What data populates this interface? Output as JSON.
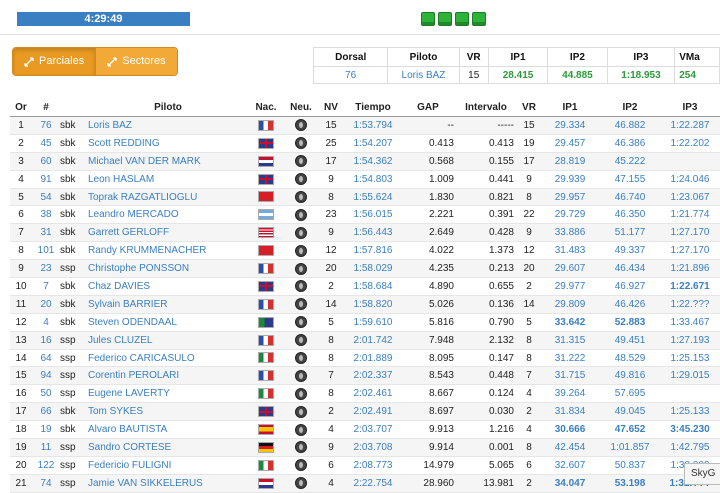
{
  "timer": "4:29:49",
  "buttons": {
    "parciales": "Parciales",
    "sectores": "Sectores"
  },
  "summary": {
    "headers": [
      "Dorsal",
      "Piloto",
      "VR",
      "IP1",
      "IP2",
      "IP3",
      "VMa"
    ],
    "values": [
      "76",
      "Loris BAZ",
      "15",
      "28.415",
      "44.885",
      "1:18.953",
      "254"
    ]
  },
  "headers": [
    "Or",
    "#",
    "",
    "Piloto",
    "Nac.",
    "Neu.",
    "NV",
    "Tiempo",
    "GAP",
    "Intervalo",
    "VR",
    "IP1",
    "IP2",
    "IP3"
  ],
  "rows": [
    [
      "1",
      "76",
      "sbk",
      "Loris BAZ",
      "fr",
      "15",
      "1:53.794",
      "--",
      "-----",
      "15",
      "29.334",
      "46.882",
      "1:22.287"
    ],
    [
      "2",
      "45",
      "sbk",
      "Scott REDDING",
      "gb",
      "25",
      "1:54.207",
      "0.413",
      "0.413",
      "19",
      "29.457",
      "46.386",
      "1:22.202"
    ],
    [
      "3",
      "60",
      "sbk",
      "Michael VAN DER MARK",
      "nl",
      "17",
      "1:54.362",
      "0.568",
      "0.155",
      "17",
      "28.819",
      "45.222",
      ""
    ],
    [
      "4",
      "91",
      "sbk",
      "Leon HASLAM",
      "gb",
      "9",
      "1:54.803",
      "1.009",
      "0.441",
      "9",
      "29.939",
      "47.155",
      "1:24.046"
    ],
    [
      "5",
      "54",
      "sbk",
      "Toprak RAZGATLIOGLU",
      "tr",
      "8",
      "1:55.624",
      "1.830",
      "0.821",
      "8",
      "29.957",
      "46.740",
      "1:23.067"
    ],
    [
      "6",
      "38",
      "sbk",
      "Leandro MERCADO",
      "ar",
      "23",
      "1:56.015",
      "2.221",
      "0.391",
      "22",
      "29.729",
      "46.350",
      "1:21.774"
    ],
    [
      "7",
      "31",
      "sbk",
      "Garrett GERLOFF",
      "us",
      "9",
      "1:56.443",
      "2.649",
      "0.428",
      "9",
      "33.886",
      "51.177",
      "1:27.170"
    ],
    [
      "8",
      "101",
      "sbk",
      "Randy KRUMMENACHER",
      "ch",
      "12",
      "1:57.816",
      "4.022",
      "1.373",
      "12",
      "31.483",
      "49.337",
      "1:27.170"
    ],
    [
      "9",
      "23",
      "ssp",
      "Christophe PONSSON",
      "fr",
      "20",
      "1:58.029",
      "4.235",
      "0.213",
      "20",
      "29.607",
      "46.434",
      "1:21.896"
    ],
    [
      "10",
      "7",
      "sbk",
      "Chaz DAVIES",
      "gb",
      "2",
      "1:58.684",
      "4.890",
      "0.655",
      "2",
      "29.977",
      "46.927",
      "1:22.671"
    ],
    [
      "11",
      "20",
      "sbk",
      "Sylvain BARRIER",
      "fr",
      "14",
      "1:58.820",
      "5.026",
      "0.136",
      "14",
      "29.809",
      "46.426",
      "1:22.???"
    ],
    [
      "12",
      "4",
      "sbk",
      "Steven ODENDAAL",
      "za",
      "5",
      "1:59.610",
      "5.816",
      "0.790",
      "5",
      "33.642",
      "52.883",
      "1:33.467"
    ],
    [
      "13",
      "16",
      "ssp",
      "Jules CLUZEL",
      "fr",
      "8",
      "2:01.742",
      "7.948",
      "2.132",
      "8",
      "31.315",
      "49.451",
      "1:27.193"
    ],
    [
      "14",
      "64",
      "ssp",
      "Federico CARICASULO",
      "it",
      "8",
      "2:01.889",
      "8.095",
      "0.147",
      "8",
      "31.222",
      "48.529",
      "1:25.153"
    ],
    [
      "15",
      "94",
      "ssp",
      "Corentin PEROLARI",
      "fr",
      "7",
      "2:02.337",
      "8.543",
      "0.448",
      "7",
      "31.715",
      "49.816",
      "1:29.015"
    ],
    [
      "16",
      "50",
      "ssp",
      "Eugene LAVERTY",
      "it",
      "8",
      "2:02.461",
      "8.667",
      "0.124",
      "4",
      "39.264",
      "57.695",
      ""
    ],
    [
      "17",
      "66",
      "sbk",
      "Tom SYKES",
      "gb",
      "2",
      "2:02.491",
      "8.697",
      "0.030",
      "2",
      "31.834",
      "49.045",
      "1:25.133"
    ],
    [
      "18",
      "19",
      "sbk",
      "Alvaro BAUTISTA",
      "es",
      "4",
      "2:03.707",
      "9.913",
      "1.216",
      "4",
      "30.666",
      "47.652",
      "3:45.230"
    ],
    [
      "19",
      "11",
      "ssp",
      "Sandro CORTESE",
      "de",
      "9",
      "2:03.708",
      "9.914",
      "0.001",
      "8",
      "42.454",
      "1:01.857",
      "1:42.795"
    ],
    [
      "20",
      "122",
      "ssp",
      "Federicio FULIGNI",
      "it",
      "6",
      "2:08.773",
      "14.979",
      "5.065",
      "6",
      "32.607",
      "50.837",
      "1:30.000"
    ],
    [
      "21",
      "74",
      "ssp",
      "Jamie VAN SIKKELERUS",
      "nl",
      "4",
      "2:22.754",
      "28.960",
      "13.981",
      "2",
      "34.047",
      "53.198",
      "1:32.???"
    ]
  ],
  "best_cells": [
    [
      9,
      12
    ],
    [
      11,
      10
    ],
    [
      11,
      11
    ],
    [
      17,
      10
    ],
    [
      17,
      11
    ],
    [
      17,
      12
    ],
    [
      20,
      10
    ],
    [
      20,
      11
    ],
    [
      20,
      12
    ]
  ],
  "tooltip": "SkyG"
}
